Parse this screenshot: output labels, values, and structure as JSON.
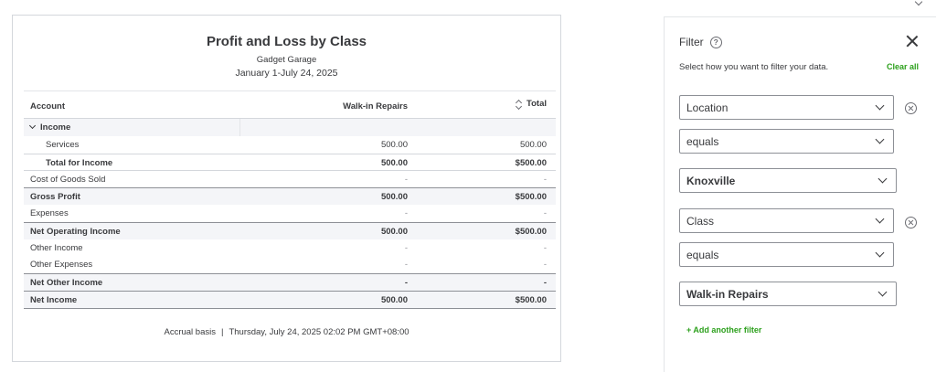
{
  "report": {
    "title": "Profit and Loss by Class",
    "company": "Gadget Garage",
    "dates": "January 1-July 24, 2025",
    "columns": {
      "account": "Account",
      "walkin": "Walk-in Repairs",
      "total": "Total"
    },
    "rows": [
      {
        "label": "Income",
        "v1": "",
        "v2": ""
      },
      {
        "label": "Services",
        "v1": "500.00",
        "v2": "500.00"
      },
      {
        "label": "Total for Income",
        "v1": "500.00",
        "v2": "$500.00"
      },
      {
        "label": "Cost of Goods Sold",
        "v1": "-",
        "v2": "-"
      },
      {
        "label": "Gross Profit",
        "v1": "500.00",
        "v2": "$500.00"
      },
      {
        "label": "Expenses",
        "v1": "-",
        "v2": "-"
      },
      {
        "label": "Net Operating Income",
        "v1": "500.00",
        "v2": "$500.00"
      },
      {
        "label": "Other Income",
        "v1": "-",
        "v2": "-"
      },
      {
        "label": "Other Expenses",
        "v1": "-",
        "v2": "-"
      },
      {
        "label": "Net Other Income",
        "v1": "-",
        "v2": "-"
      },
      {
        "label": "Net Income",
        "v1": "500.00",
        "v2": "$500.00"
      }
    ],
    "footer": {
      "basis": "Accrual basis",
      "separator": "|",
      "timestamp": "Thursday, July 24, 2025 02:02 PM GMT+08:00"
    }
  },
  "filter": {
    "title": "Filter",
    "help_symbol": "?",
    "subtitle": "Select how you want to filter your data.",
    "clear_all": "Clear all",
    "filters": [
      {
        "field": "Location",
        "operator": "equals",
        "value": "Knoxville"
      },
      {
        "field": "Class",
        "operator": "equals",
        "value": "Walk-in Repairs"
      }
    ],
    "add_filter": "+ Add another filter"
  }
}
